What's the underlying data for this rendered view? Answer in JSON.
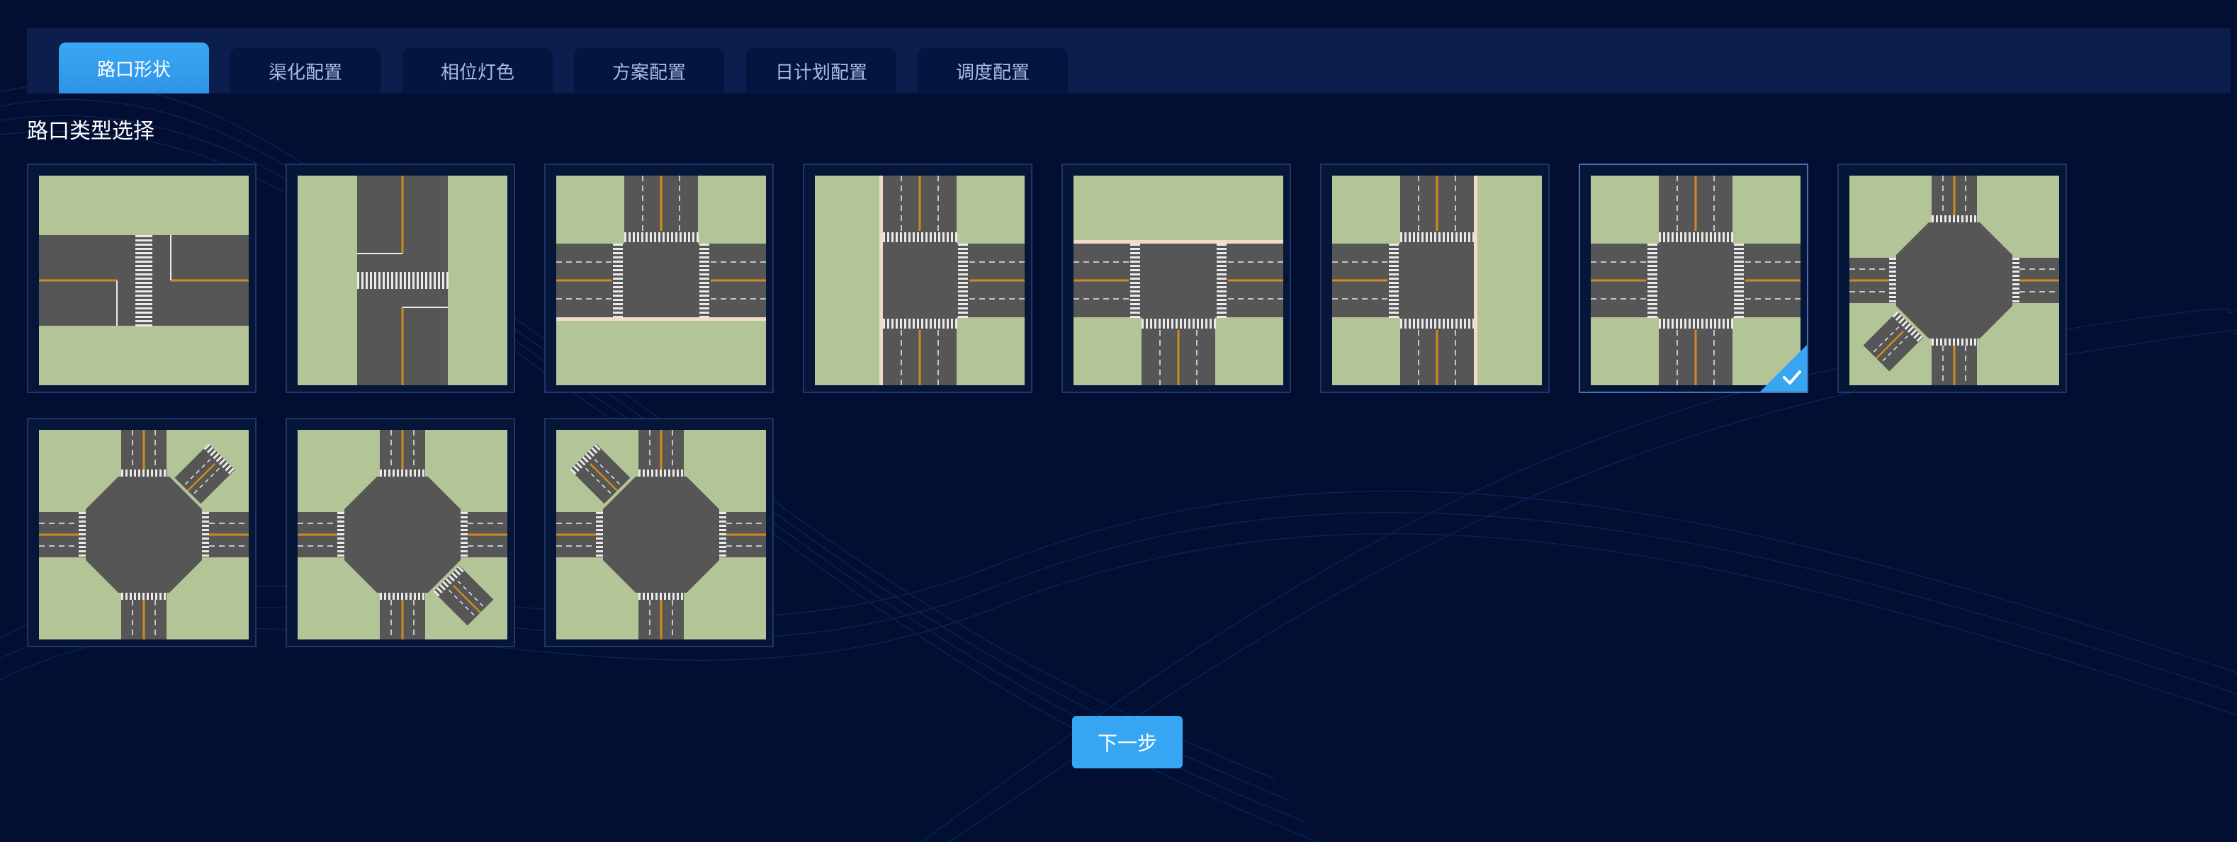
{
  "tabs": [
    {
      "label": "路口形状",
      "active": true
    },
    {
      "label": "渠化配置",
      "active": false
    },
    {
      "label": "相位灯色",
      "active": false
    },
    {
      "label": "方案配置",
      "active": false
    },
    {
      "label": "日计划配置",
      "active": false
    },
    {
      "label": "调度配置",
      "active": false
    }
  ],
  "section": {
    "title": "路口类型选择"
  },
  "intersection_types": [
    {
      "shape": "straight-horizontal",
      "selected": false
    },
    {
      "shape": "straight-vertical",
      "selected": false
    },
    {
      "shape": "t-junction-no-south",
      "selected": false
    },
    {
      "shape": "t-junction-no-west",
      "selected": false
    },
    {
      "shape": "t-junction-no-north",
      "selected": false
    },
    {
      "shape": "t-junction-no-east",
      "selected": false
    },
    {
      "shape": "crossroads",
      "selected": true
    },
    {
      "shape": "octagon-five-way-southwest",
      "selected": false
    },
    {
      "shape": "octagon-five-way-northeast",
      "selected": false
    },
    {
      "shape": "octagon-five-way-southeast",
      "selected": false
    },
    {
      "shape": "octagon-five-way-northwest",
      "selected": false
    }
  ],
  "colors": {
    "accent": "#36a6f2",
    "grass": "#b3c597",
    "road": "#565656",
    "background": "#020f33"
  },
  "next_button": {
    "label": "下一步"
  }
}
